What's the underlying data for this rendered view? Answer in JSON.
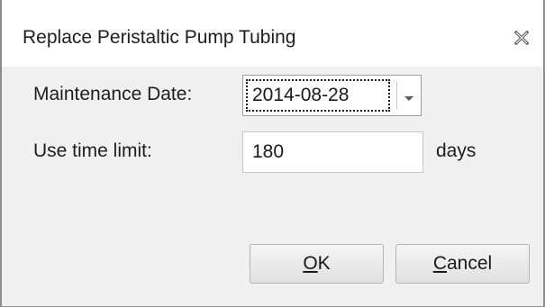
{
  "dialog": {
    "title": "Replace Peristaltic Pump Tubing",
    "close_icon": "close-icon"
  },
  "maintenance_date": {
    "label": "Maintenance Date:",
    "value": "2014-08-28",
    "dropdown_icon": "chevron-down-icon"
  },
  "use_time_limit": {
    "label": "Use time limit:",
    "value": "180",
    "unit": "days"
  },
  "buttons": {
    "ok": {
      "mnemonic": "O",
      "rest": "K"
    },
    "cancel": {
      "mnemonic": "C",
      "rest": "ancel"
    }
  }
}
